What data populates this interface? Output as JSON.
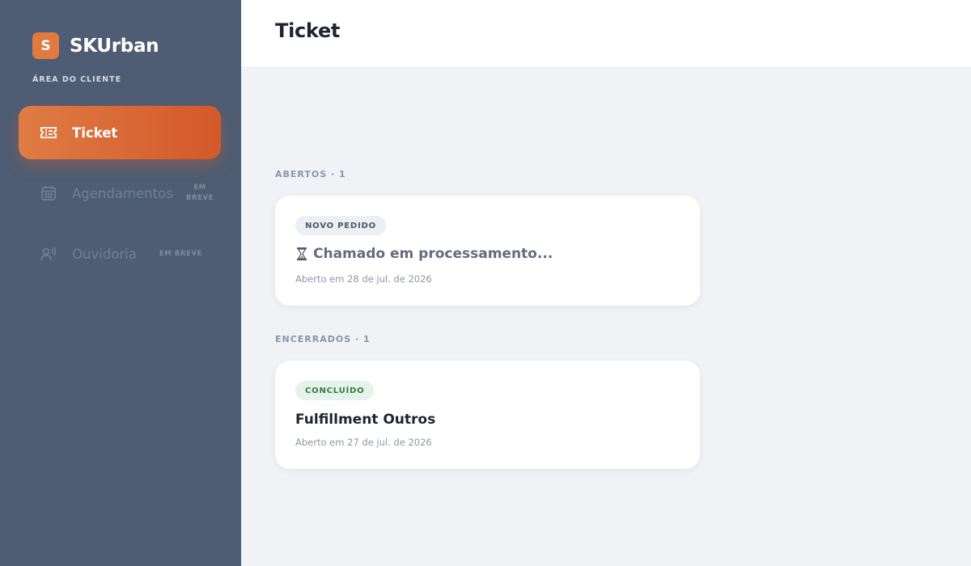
{
  "sidebar": {
    "brand": {
      "logo_letter": "S",
      "name": "SKUrban",
      "logo_color": "#e07a3f"
    },
    "area_label": "ÁREA DO CLIENTE",
    "items": [
      {
        "label": "Ticket",
        "icon": "ticket-icon",
        "active": true
      },
      {
        "label": "Agendamentos",
        "icon": "calendar-icon",
        "badge_line1": "EM",
        "badge_line2": "BREVE"
      },
      {
        "label": "Ouvidoria",
        "icon": "voice-icon",
        "badge": "EM BREVE"
      }
    ]
  },
  "header": {
    "title": "Ticket"
  },
  "sections": {
    "open": {
      "heading": "ABERTOS · 1",
      "tickets": [
        {
          "status": "NOVO PEDIDO",
          "title": "Chamado em processamento...",
          "title_icon": "hourglass-icon",
          "date": "Aberto em 28 de jul. de 2026"
        }
      ]
    },
    "closed": {
      "heading": "ENCERRADOS · 1",
      "tickets": [
        {
          "status": "CONCLUÍDO",
          "title": "Fulfillment Outros",
          "date": "Aberto em 27 de jul. de 2026"
        }
      ]
    }
  },
  "colors": {
    "sidebar_bg": "#4e5d73",
    "accent": "#df7c44",
    "success": "#2e7d4a",
    "page_bg": "#f1f2f6"
  }
}
